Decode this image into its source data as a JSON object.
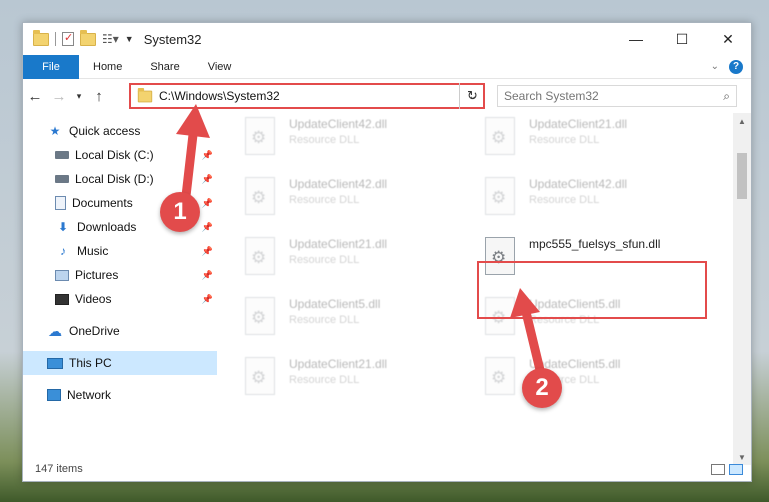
{
  "window": {
    "title": "System32",
    "controls": {
      "minimize": "—",
      "maximize": "☐",
      "close": "✕"
    }
  },
  "ribbon": {
    "file": "File",
    "tabs": [
      "Home",
      "Share",
      "View"
    ]
  },
  "address": {
    "path": "C:\\Windows\\System32",
    "search_placeholder": "Search System32"
  },
  "sidebar": {
    "quick_access": "Quick access",
    "items": [
      {
        "label": "Local Disk (C:)",
        "icon": "drive-icon"
      },
      {
        "label": "Local Disk (D:)",
        "icon": "drive-icon"
      },
      {
        "label": "Documents",
        "icon": "documents-icon"
      },
      {
        "label": "Downloads",
        "icon": "downloads-icon"
      },
      {
        "label": "Music",
        "icon": "music-icon"
      },
      {
        "label": "Pictures",
        "icon": "pictures-icon"
      },
      {
        "label": "Videos",
        "icon": "videos-icon"
      }
    ],
    "onedrive": "OneDrive",
    "this_pc": "This PC",
    "network": "Network"
  },
  "files": [
    {
      "name": "UpdateClient42.dll",
      "type": "Resource DLL"
    },
    {
      "name": "UpdateClient21.dll",
      "type": "Resource DLL"
    },
    {
      "name": "UpdateClient42.dll",
      "type": "Resource DLL"
    },
    {
      "name": "UpdateClient42.dll",
      "type": "Resource DLL"
    },
    {
      "name": "UpdateClient21.dll",
      "type": "Resource DLL"
    },
    {
      "name": "mpc555_fuelsys_sfun.dll",
      "type": ""
    },
    {
      "name": "UpdateClient5.dll",
      "type": "Resource DLL"
    },
    {
      "name": "UpdateClient5.dll",
      "type": "Resource DLL"
    },
    {
      "name": "UpdateClient21.dll",
      "type": "Resource DLL"
    },
    {
      "name": "UpdateClient5.dll",
      "type": "Resource DLL"
    }
  ],
  "status": {
    "count": "147 items"
  },
  "annotations": {
    "step1": "1",
    "step2": "2"
  },
  "colors": {
    "accent": "#1979ca",
    "annotation": "#e34b4b",
    "selected": "#cce8ff"
  }
}
